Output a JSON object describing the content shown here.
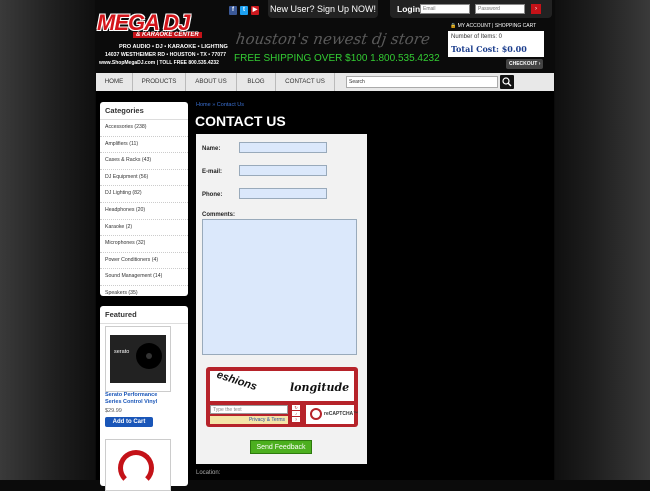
{
  "header": {
    "logo": {
      "name": "MEGA DJ",
      "subtitle": "& KARAOKE CENTER",
      "line1": "PRO AUDIO • DJ • KARAOKE • LIGHTING",
      "line2": "14037 WESTHEIMER RD • HOUSTON • TX • 77077",
      "line3": "www.ShopMegaDJ.com  |  TOLL FREE 800.535.4232"
    },
    "social_icons": [
      "facebook-icon",
      "twitter-icon",
      "youtube-icon"
    ],
    "signup_text": "New User? Sign Up NOW!",
    "login_label": "Login",
    "email_placeholder": "Email",
    "password_placeholder": "Password",
    "login_go": "›",
    "tagline": "houston's newest dj store",
    "shipping": "FREE SHIPPING OVER $100    1.800.535.4232",
    "account_links": "MY ACCOUNT  |  SHOPPING CART",
    "cart_items": "Number of Items: 0",
    "cart_total": "Total Cost: $0.00",
    "checkout": "CHECKOUT ›"
  },
  "nav": {
    "items": [
      "HOME",
      "PRODUCTS",
      "ABOUT US",
      "BLOG",
      "CONTACT US"
    ],
    "search_value": "Search"
  },
  "categories": {
    "title": "Categories",
    "items": [
      "Accessories (238)",
      "Amplifiers (11)",
      "Cases & Racks (43)",
      "DJ Equipment (56)",
      "DJ Lighting (82)",
      "Headphones (20)",
      "Karaoke (2)",
      "Microphones (32)",
      "Power Conditioners (4)",
      "Sound Management (14)",
      "Speakers (35)"
    ]
  },
  "featured": {
    "title": "Featured",
    "product1": {
      "logo": "serato",
      "name": "Serato Performance Series Control Vinyl",
      "price": "$29.99",
      "add_to_cart": "Add to Cart"
    }
  },
  "contact": {
    "breadcrumb_home": "Home",
    "breadcrumb_sep": " » ",
    "breadcrumb_current": "Contact Us",
    "title": "CONTACT US",
    "name_label": "Name:",
    "email_label": "E-mail:",
    "phone_label": "Phone:",
    "comments_label": "Comments:",
    "captcha_word1": "eshions",
    "captcha_word2": "longitude",
    "captcha_placeholder": "Type the text",
    "captcha_privacy": "Privacy & Terms",
    "captcha_brand": "reCAPTCHA™",
    "submit": "Send Feedback",
    "location_label": "Location:"
  }
}
